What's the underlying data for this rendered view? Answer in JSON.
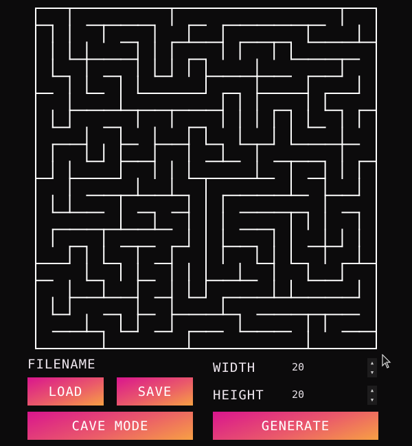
{
  "maze": {
    "wall_color": "#ffffff",
    "background_color": "#0c0b0c",
    "cols": 20,
    "rows": 20
  },
  "controls": {
    "filename_label": "FILENAME",
    "load_button": "LOAD",
    "save_button": "SAVE",
    "cave_mode_button": "CAVE MODE",
    "generate_button": "GENERATE",
    "width_label": "WIDTH",
    "width_value": "20",
    "height_label": "HEIGHT",
    "height_value": "20",
    "spin_up_icon": "triangle-up",
    "spin_down_icon": "triangle-down"
  },
  "theme": {
    "button_gradient_start": "#d9158e",
    "button_gradient_end": "#f7a044"
  }
}
